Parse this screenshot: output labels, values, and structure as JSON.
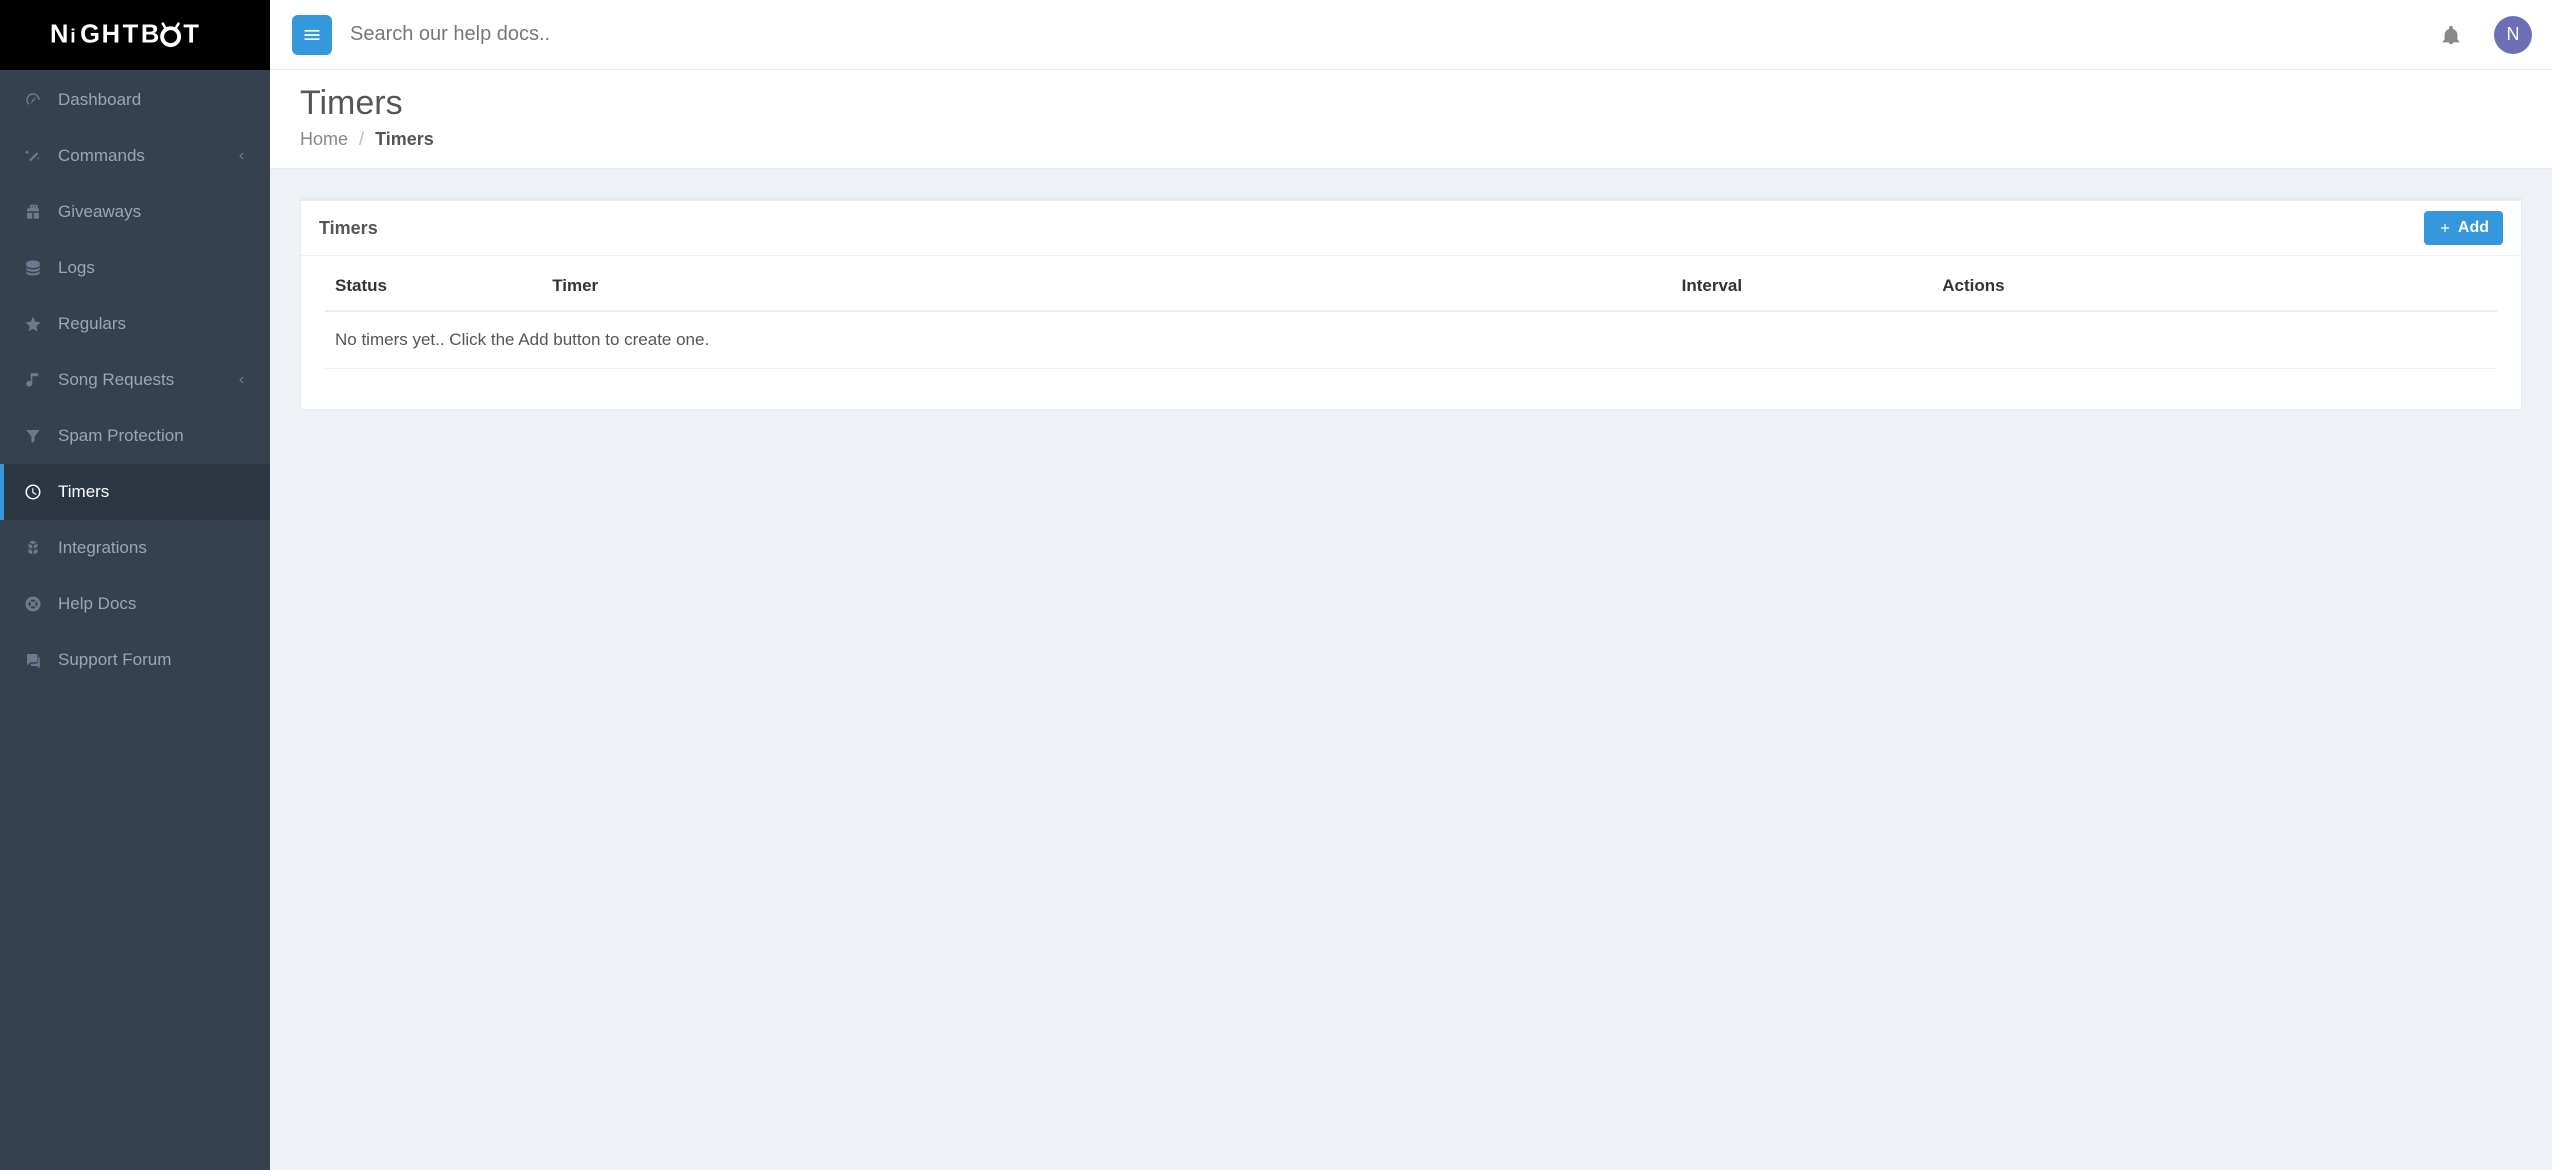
{
  "brand": "NightBot",
  "topbar": {
    "search_placeholder": "Search our help docs..",
    "avatar_letter": "N"
  },
  "sidebar": {
    "items": [
      {
        "id": "dashboard",
        "label": "Dashboard",
        "icon": "dashboard-icon",
        "has_submenu": false,
        "active": false
      },
      {
        "id": "commands",
        "label": "Commands",
        "icon": "wand-icon",
        "has_submenu": true,
        "active": false
      },
      {
        "id": "giveaways",
        "label": "Giveaways",
        "icon": "gift-icon",
        "has_submenu": false,
        "active": false
      },
      {
        "id": "logs",
        "label": "Logs",
        "icon": "database-icon",
        "has_submenu": false,
        "active": false
      },
      {
        "id": "regulars",
        "label": "Regulars",
        "icon": "star-icon",
        "has_submenu": false,
        "active": false
      },
      {
        "id": "song-requests",
        "label": "Song Requests",
        "icon": "music-icon",
        "has_submenu": true,
        "active": false
      },
      {
        "id": "spam-protection",
        "label": "Spam Protection",
        "icon": "filter-icon",
        "has_submenu": false,
        "active": false
      },
      {
        "id": "timers",
        "label": "Timers",
        "icon": "clock-icon",
        "has_submenu": false,
        "active": true
      },
      {
        "id": "integrations",
        "label": "Integrations",
        "icon": "cubes-icon",
        "has_submenu": false,
        "active": false
      },
      {
        "id": "help-docs",
        "label": "Help Docs",
        "icon": "lifering-icon",
        "has_submenu": false,
        "active": false
      },
      {
        "id": "support-forum",
        "label": "Support Forum",
        "icon": "comments-icon",
        "has_submenu": false,
        "active": false
      }
    ]
  },
  "page": {
    "title": "Timers",
    "breadcrumb": {
      "home": "Home",
      "current": "Timers"
    }
  },
  "panel": {
    "title": "Timers",
    "add_label": "Add",
    "columns": {
      "status": "Status",
      "timer": "Timer",
      "interval": "Interval",
      "actions": "Actions"
    },
    "rows": [],
    "empty_message": "No timers yet.. Click the Add button to create one."
  },
  "colors": {
    "accent": "#3598dc",
    "sidebar_bg": "#364150",
    "sidebar_active_bg": "#2c3542",
    "page_bg": "#eef1f5"
  }
}
